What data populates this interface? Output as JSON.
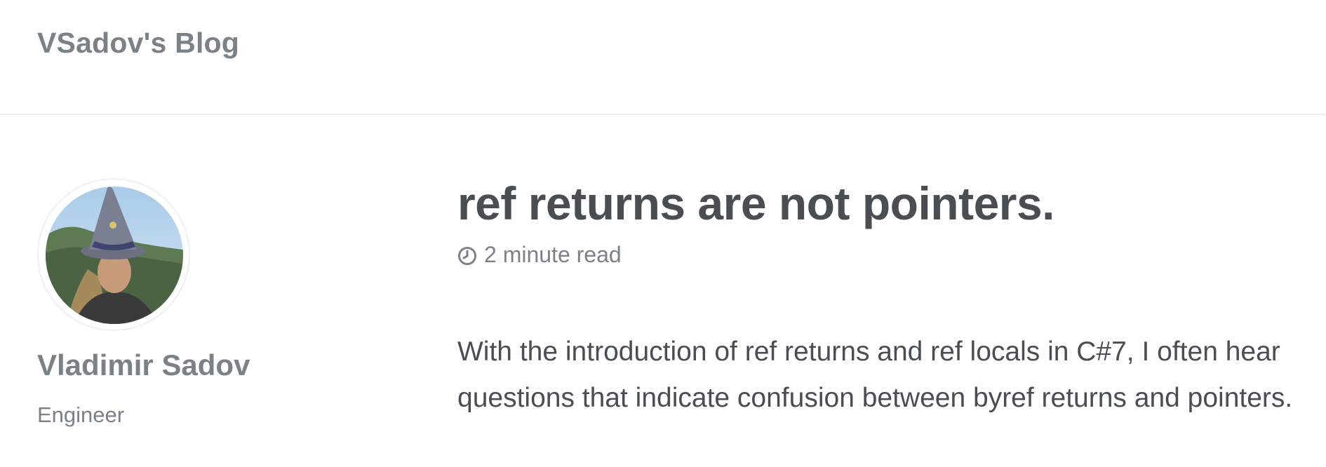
{
  "site": {
    "title": "VSadov's Blog"
  },
  "author": {
    "name": "Vladimir Sadov",
    "bio": "Engineer",
    "avatar_icon": "author-photo-wizard-hat"
  },
  "post": {
    "title": "ref returns are not pointers.",
    "read_time": "2 minute read",
    "read_time_icon": "clock-icon",
    "lead": "With the introduction of ref returns and ref locals in C#7, I often hear questions that indicate confusion between byref returns and pointers."
  },
  "colors": {
    "muted_text": "#7a8288",
    "body_text": "#494e52",
    "divider": "#eeeeee"
  }
}
